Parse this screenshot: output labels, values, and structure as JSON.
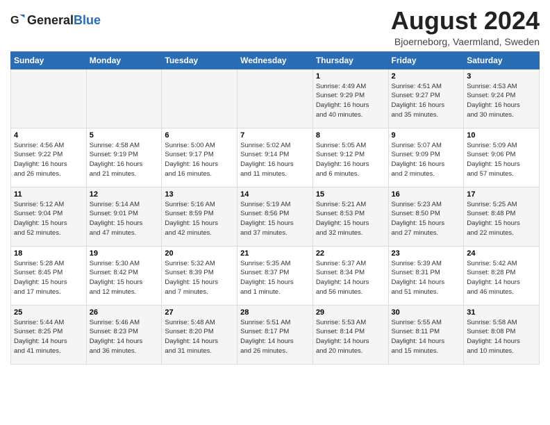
{
  "header": {
    "logo_general": "General",
    "logo_blue": "Blue",
    "month_title": "August 2024",
    "subtitle": "Bjoerneborg, Vaermland, Sweden"
  },
  "days_of_week": [
    "Sunday",
    "Monday",
    "Tuesday",
    "Wednesday",
    "Thursday",
    "Friday",
    "Saturday"
  ],
  "weeks": [
    [
      {
        "day": "",
        "info": ""
      },
      {
        "day": "",
        "info": ""
      },
      {
        "day": "",
        "info": ""
      },
      {
        "day": "",
        "info": ""
      },
      {
        "day": "1",
        "info": "Sunrise: 4:49 AM\nSunset: 9:29 PM\nDaylight: 16 hours\nand 40 minutes."
      },
      {
        "day": "2",
        "info": "Sunrise: 4:51 AM\nSunset: 9:27 PM\nDaylight: 16 hours\nand 35 minutes."
      },
      {
        "day": "3",
        "info": "Sunrise: 4:53 AM\nSunset: 9:24 PM\nDaylight: 16 hours\nand 30 minutes."
      }
    ],
    [
      {
        "day": "4",
        "info": "Sunrise: 4:56 AM\nSunset: 9:22 PM\nDaylight: 16 hours\nand 26 minutes."
      },
      {
        "day": "5",
        "info": "Sunrise: 4:58 AM\nSunset: 9:19 PM\nDaylight: 16 hours\nand 21 minutes."
      },
      {
        "day": "6",
        "info": "Sunrise: 5:00 AM\nSunset: 9:17 PM\nDaylight: 16 hours\nand 16 minutes."
      },
      {
        "day": "7",
        "info": "Sunrise: 5:02 AM\nSunset: 9:14 PM\nDaylight: 16 hours\nand 11 minutes."
      },
      {
        "day": "8",
        "info": "Sunrise: 5:05 AM\nSunset: 9:12 PM\nDaylight: 16 hours\nand 6 minutes."
      },
      {
        "day": "9",
        "info": "Sunrise: 5:07 AM\nSunset: 9:09 PM\nDaylight: 16 hours\nand 2 minutes."
      },
      {
        "day": "10",
        "info": "Sunrise: 5:09 AM\nSunset: 9:06 PM\nDaylight: 15 hours\nand 57 minutes."
      }
    ],
    [
      {
        "day": "11",
        "info": "Sunrise: 5:12 AM\nSunset: 9:04 PM\nDaylight: 15 hours\nand 52 minutes."
      },
      {
        "day": "12",
        "info": "Sunrise: 5:14 AM\nSunset: 9:01 PM\nDaylight: 15 hours\nand 47 minutes."
      },
      {
        "day": "13",
        "info": "Sunrise: 5:16 AM\nSunset: 8:59 PM\nDaylight: 15 hours\nand 42 minutes."
      },
      {
        "day": "14",
        "info": "Sunrise: 5:19 AM\nSunset: 8:56 PM\nDaylight: 15 hours\nand 37 minutes."
      },
      {
        "day": "15",
        "info": "Sunrise: 5:21 AM\nSunset: 8:53 PM\nDaylight: 15 hours\nand 32 minutes."
      },
      {
        "day": "16",
        "info": "Sunrise: 5:23 AM\nSunset: 8:50 PM\nDaylight: 15 hours\nand 27 minutes."
      },
      {
        "day": "17",
        "info": "Sunrise: 5:25 AM\nSunset: 8:48 PM\nDaylight: 15 hours\nand 22 minutes."
      }
    ],
    [
      {
        "day": "18",
        "info": "Sunrise: 5:28 AM\nSunset: 8:45 PM\nDaylight: 15 hours\nand 17 minutes."
      },
      {
        "day": "19",
        "info": "Sunrise: 5:30 AM\nSunset: 8:42 PM\nDaylight: 15 hours\nand 12 minutes."
      },
      {
        "day": "20",
        "info": "Sunrise: 5:32 AM\nSunset: 8:39 PM\nDaylight: 15 hours\nand 7 minutes."
      },
      {
        "day": "21",
        "info": "Sunrise: 5:35 AM\nSunset: 8:37 PM\nDaylight: 15 hours\nand 1 minute."
      },
      {
        "day": "22",
        "info": "Sunrise: 5:37 AM\nSunset: 8:34 PM\nDaylight: 14 hours\nand 56 minutes."
      },
      {
        "day": "23",
        "info": "Sunrise: 5:39 AM\nSunset: 8:31 PM\nDaylight: 14 hours\nand 51 minutes."
      },
      {
        "day": "24",
        "info": "Sunrise: 5:42 AM\nSunset: 8:28 PM\nDaylight: 14 hours\nand 46 minutes."
      }
    ],
    [
      {
        "day": "25",
        "info": "Sunrise: 5:44 AM\nSunset: 8:25 PM\nDaylight: 14 hours\nand 41 minutes."
      },
      {
        "day": "26",
        "info": "Sunrise: 5:46 AM\nSunset: 8:23 PM\nDaylight: 14 hours\nand 36 minutes."
      },
      {
        "day": "27",
        "info": "Sunrise: 5:48 AM\nSunset: 8:20 PM\nDaylight: 14 hours\nand 31 minutes."
      },
      {
        "day": "28",
        "info": "Sunrise: 5:51 AM\nSunset: 8:17 PM\nDaylight: 14 hours\nand 26 minutes."
      },
      {
        "day": "29",
        "info": "Sunrise: 5:53 AM\nSunset: 8:14 PM\nDaylight: 14 hours\nand 20 minutes."
      },
      {
        "day": "30",
        "info": "Sunrise: 5:55 AM\nSunset: 8:11 PM\nDaylight: 14 hours\nand 15 minutes."
      },
      {
        "day": "31",
        "info": "Sunrise: 5:58 AM\nSunset: 8:08 PM\nDaylight: 14 hours\nand 10 minutes."
      }
    ]
  ]
}
